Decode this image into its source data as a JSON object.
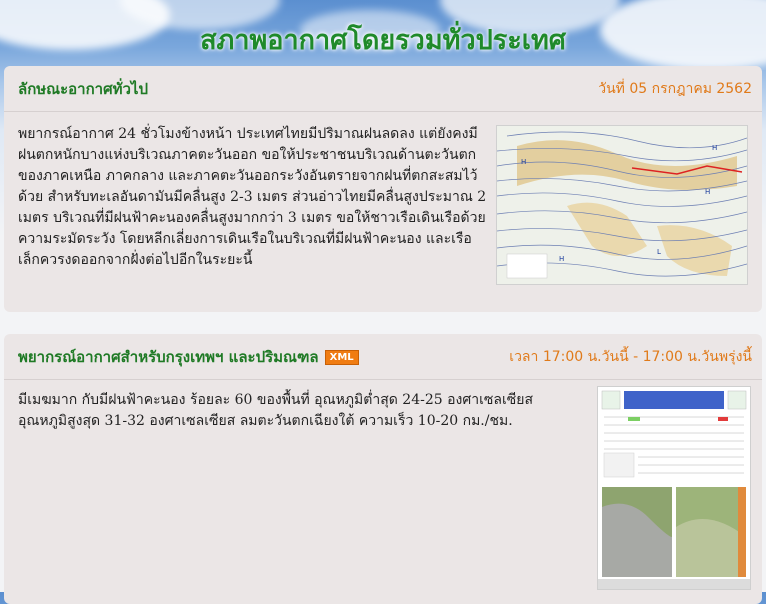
{
  "page": {
    "title": "สภาพอากาศโดยรวมทั่วประเทศ"
  },
  "general": {
    "title": "ลักษณะอากาศทั่วไป",
    "date": "วันที่ 05 กรกฎาคม 2562",
    "text": "พยากรณ์อากาศ 24 ชั่วโมงข้างหน้า ประเทศไทยมีปริมาณฝนลดลง แต่ยังคงมีฝนตกหนักบางแห่งบริเวณภาคตะวันออก ขอให้ประชาชนบริเวณด้านตะวันตกของภาคเหนือ ภาคกลาง และภาคตะวันออกระวังอันตรายจากฝนที่ตกสะสมไว้ด้วย สำหรับทะเลอันดามันมีคลื่นสูง 2-3 เมตร ส่วนอ่าวไทยมีคลื่นสูงประมาณ 2 เมตร บริเวณที่มีฝนฟ้าคะนองคลื่นสูงมากกว่า 3 เมตร ขอให้ชาวเรือเดินเรือด้วยความระมัดระวัง โดยหลีกเลี่ยงการเดินเรือในบริเวณที่มีฝนฟ้าคะนอง และเรือเล็กควรงดออกจากฝั่งต่อไปอีกในระยะนี้"
  },
  "bangkok": {
    "title": "พยากรณ์อากาศสำหรับกรุงเทพฯ และปริมณฑล",
    "xml_label": "XML",
    "time": "เวลา 17:00 น.วันนี้ - 17:00 น.วันพรุ่งนี้",
    "text": "มีเมฆมาก กับมีฝนฟ้าคะนอง ร้อยละ 60 ของพื้นที่ อุณหภูมิต่ำสุด 24-25 องศาเซลเซียส อุณหภูมิสูงสุด 31-32 องศาเซลเซียส ลมตะวันตกเฉียงใต้ ความเร็ว 10-20 กม./ชม."
  }
}
